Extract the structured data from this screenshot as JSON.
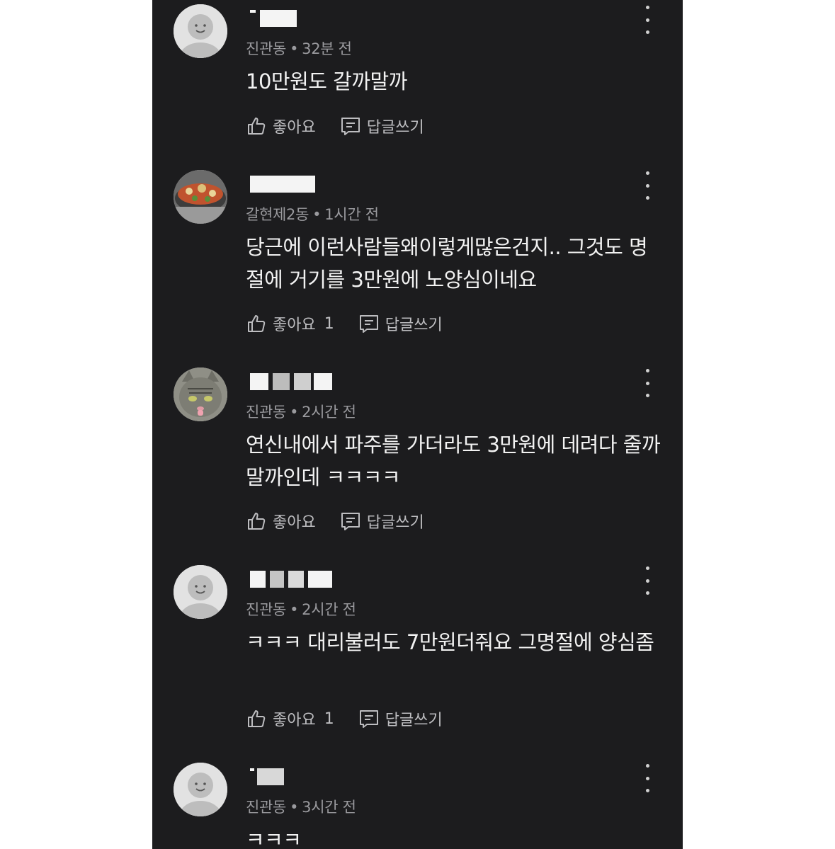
{
  "comments": [
    {
      "meta": {
        "location": "진관동",
        "time": "32분 전"
      },
      "text": "10만원도 갈까말까",
      "like_label": "좋아요",
      "like_count": "",
      "reply_label": "답글쓰기",
      "avatar": "default-avatar"
    },
    {
      "meta": {
        "location": "갈현제2동",
        "time": "1시간 전"
      },
      "text": "당근에 이런사람들왜이렇게많은건지.. 그것도 명절에 거기를 3만원에 노양심이네요",
      "like_label": "좋아요",
      "like_count": "1",
      "reply_label": "답글쓰기",
      "avatar": "food-photo-avatar"
    },
    {
      "meta": {
        "location": "진관동",
        "time": "2시간 전"
      },
      "text": "연신내에서 파주를 가더라도 3만원에 데려다 줄까말까인데 ㅋㅋㅋㅋ",
      "like_label": "좋아요",
      "like_count": "",
      "reply_label": "답글쓰기",
      "avatar": "cat-photo-avatar"
    },
    {
      "meta": {
        "location": "진관동",
        "time": "2시간 전"
      },
      "text": "ㅋㅋㅋ 대리불러도 7만원더줘요 그명절에 양심좀",
      "like_label": "좋아요",
      "like_count": "1",
      "reply_label": "답글쓰기",
      "avatar": "default-avatar"
    },
    {
      "meta": {
        "location": "진관동",
        "time": "3시간 전"
      },
      "text": "ㅋㅋㅋ",
      "like_label": "",
      "like_count": "",
      "reply_label": "",
      "avatar": "default-avatar"
    }
  ],
  "colors": {
    "background": "#1c1c1e",
    "text": "#f2f2f2",
    "meta": "#9a9a9e",
    "action": "#bdbdc0"
  }
}
